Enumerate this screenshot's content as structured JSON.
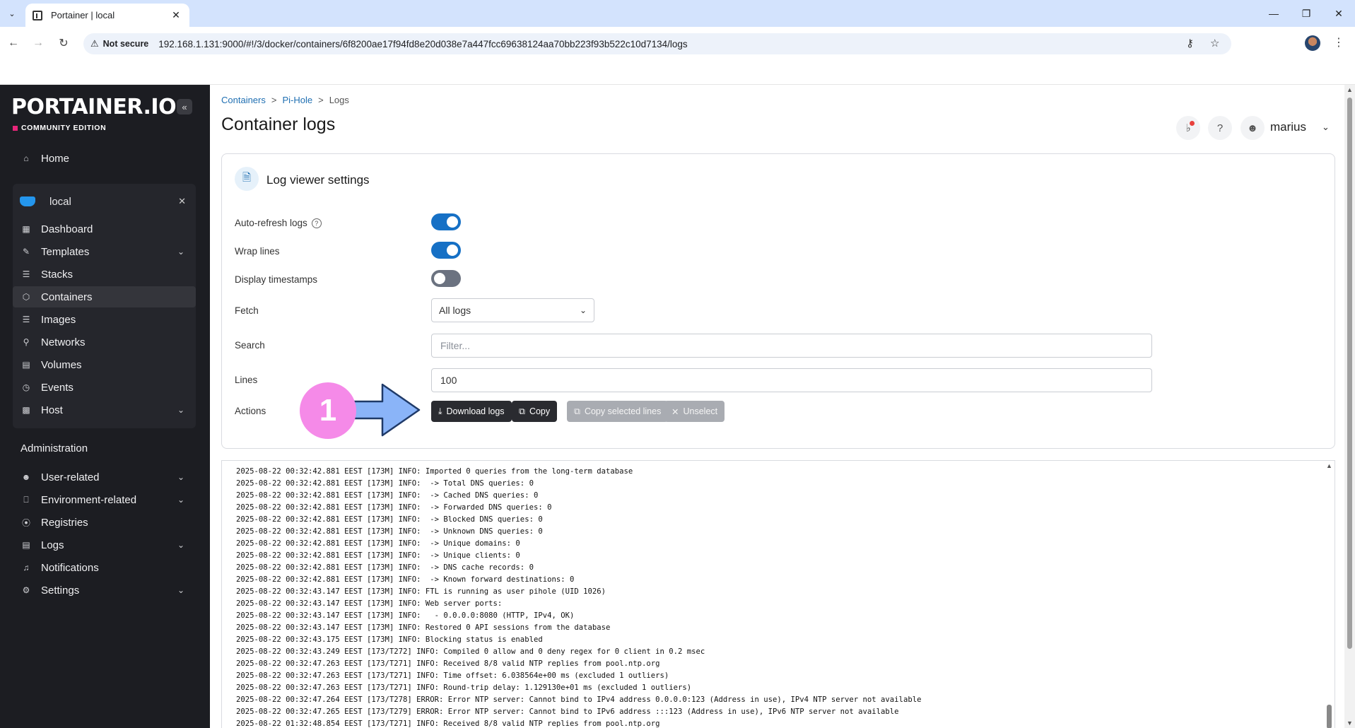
{
  "browser": {
    "tab_title": "Portainer | local",
    "not_secure": "Not secure",
    "url": "192.168.1.131:9000/#!/3/docker/containers/6f8200ae17f94fd8e20d038e7a447fcc69638124aa70bb223f93b522c10d7134/logs"
  },
  "sidebar": {
    "logo": "PORTAINER.IO",
    "edition": "COMMUNITY EDITION",
    "home": "Home",
    "environment": "local",
    "env_items": [
      {
        "label": "Dashboard",
        "icon": "dashboard-icon"
      },
      {
        "label": "Templates",
        "icon": "templates-icon",
        "expandable": true
      },
      {
        "label": "Stacks",
        "icon": "stacks-icon"
      },
      {
        "label": "Containers",
        "icon": "containers-icon",
        "active": true
      },
      {
        "label": "Images",
        "icon": "images-icon"
      },
      {
        "label": "Networks",
        "icon": "networks-icon"
      },
      {
        "label": "Volumes",
        "icon": "volumes-icon"
      },
      {
        "label": "Events",
        "icon": "events-icon"
      },
      {
        "label": "Host",
        "icon": "host-icon",
        "expandable": true
      }
    ],
    "admin_heading": "Administration",
    "admin_items": [
      {
        "label": "User-related",
        "expandable": true
      },
      {
        "label": "Environment-related",
        "expandable": true
      },
      {
        "label": "Registries"
      },
      {
        "label": "Logs",
        "expandable": true
      },
      {
        "label": "Notifications"
      },
      {
        "label": "Settings",
        "expandable": true
      }
    ]
  },
  "header": {
    "breadcrumb": [
      "Containers",
      "Pi-Hole",
      "Logs"
    ],
    "title": "Container logs",
    "user": "marius"
  },
  "settings": {
    "title": "Log viewer settings",
    "auto_refresh_label": "Auto-refresh logs",
    "auto_refresh": true,
    "wrap_label": "Wrap lines",
    "wrap": true,
    "timestamps_label": "Display timestamps",
    "timestamps": false,
    "fetch_label": "Fetch",
    "fetch_value": "All logs",
    "search_label": "Search",
    "search_placeholder": "Filter...",
    "lines_label": "Lines",
    "lines_value": "100",
    "actions_label": "Actions",
    "btn_download": "Download logs",
    "btn_copy": "Copy",
    "btn_copy_selected": "Copy selected lines",
    "btn_unselect": "Unselect"
  },
  "annotation": "1",
  "logs": [
    "2025-08-22 00:32:42.881 EEST [173M] INFO: Imported 0 queries from the long-term database",
    "2025-08-22 00:32:42.881 EEST [173M] INFO:  -> Total DNS queries: 0",
    "2025-08-22 00:32:42.881 EEST [173M] INFO:  -> Cached DNS queries: 0",
    "2025-08-22 00:32:42.881 EEST [173M] INFO:  -> Forwarded DNS queries: 0",
    "2025-08-22 00:32:42.881 EEST [173M] INFO:  -> Blocked DNS queries: 0",
    "2025-08-22 00:32:42.881 EEST [173M] INFO:  -> Unknown DNS queries: 0",
    "2025-08-22 00:32:42.881 EEST [173M] INFO:  -> Unique domains: 0",
    "2025-08-22 00:32:42.881 EEST [173M] INFO:  -> Unique clients: 0",
    "2025-08-22 00:32:42.881 EEST [173M] INFO:  -> DNS cache records: 0",
    "2025-08-22 00:32:42.881 EEST [173M] INFO:  -> Known forward destinations: 0",
    "2025-08-22 00:32:43.147 EEST [173M] INFO: FTL is running as user pihole (UID 1026)",
    "2025-08-22 00:32:43.147 EEST [173M] INFO: Web server ports:",
    "2025-08-22 00:32:43.147 EEST [173M] INFO:   - 0.0.0.0:8080 (HTTP, IPv4, OK)",
    "2025-08-22 00:32:43.147 EEST [173M] INFO: Restored 0 API sessions from the database",
    "2025-08-22 00:32:43.175 EEST [173M] INFO: Blocking status is enabled",
    "2025-08-22 00:32:43.249 EEST [173/T272] INFO: Compiled 0 allow and 0 deny regex for 0 client in 0.2 msec",
    "2025-08-22 00:32:47.263 EEST [173/T271] INFO: Received 8/8 valid NTP replies from pool.ntp.org",
    "2025-08-22 00:32:47.263 EEST [173/T271] INFO: Time offset: 6.038564e+00 ms (excluded 1 outliers)",
    "2025-08-22 00:32:47.263 EEST [173/T271] INFO: Round-trip delay: 1.129130e+01 ms (excluded 1 outliers)",
    "2025-08-22 00:32:47.264 EEST [173/T278] ERROR: Error NTP server: Cannot bind to IPv4 address 0.0.0.0:123 (Address in use), IPv4 NTP server not available",
    "2025-08-22 00:32:47.265 EEST [173/T279] ERROR: Error NTP server: Cannot bind to IPv6 address :::123 (Address in use), IPv6 NTP server not available",
    "2025-08-22 01:32:48.854 EEST [173/T271] INFO: Received 8/8 valid NTP replies from pool.ntp.org"
  ]
}
